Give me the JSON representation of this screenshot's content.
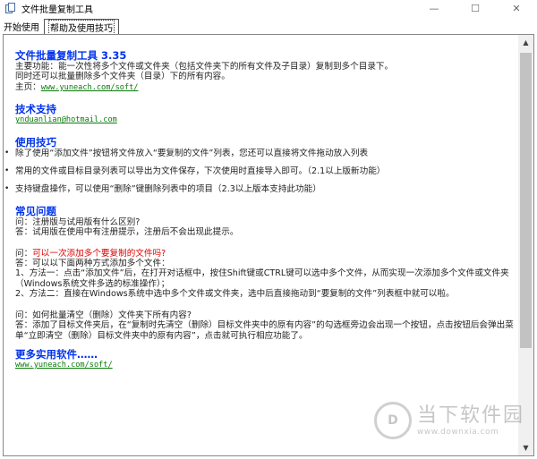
{
  "window": {
    "title": "文件批量复制工具",
    "controls": {
      "minimize": "—",
      "maximize": "☐",
      "close": "✕"
    }
  },
  "tabs": [
    {
      "label": "开始使用",
      "active": false
    },
    {
      "label": "帮助及使用技巧",
      "active": true
    }
  ],
  "help": {
    "product_heading": "文件批量复制工具 3.35",
    "features_line1": "主要功能：能一次性将多个文件或文件夹（包括文件夹下的所有文件及子目录）复制到多个目录下。",
    "features_line2": "同时还可以批量删除多个文件夹（目录）下的所有内容。",
    "homepage_label": "主页：",
    "homepage_link": "www.yuneach.com/soft/",
    "support_heading": "技术支持",
    "support_email": "ynduanlian@hotmail.com",
    "tips_heading": "使用技巧",
    "tips": [
      "除了使用“添加文件”按钮将文件放入“要复制的文件”列表，您还可以直接将文件拖动放入列表",
      "常用的文件或目标目录列表可以导出为文件保存，下次使用时直接导入即可。（2.1以上版新功能）",
      "支持键盘操作，可以使用“删除”键删除列表中的项目（2.3以上版本支持此功能）"
    ],
    "faq_heading": "常见问题",
    "faq1_q": "问：注册版与试用版有什么区别?",
    "faq1_a": "答：试用版在使用中有注册提示，注册后不会出现此提示。",
    "faq2_q_prefix": "问：",
    "faq2_q": "可以一次添加多个要复制的文件吗?",
    "faq2_a_line1": "答：可以以下面两种方式添加多个文件：",
    "faq2_a_line2": "1、方法一：点击“添加文件”后，在打开对话框中，按住Shift键或CTRL键可以选中多个文件，从而实现一次添加多个文件或文件夹（Windows系统文件多选的标准操作）；",
    "faq2_a_line3": "2、方法二：直接在Windows系统中选中多个文件或文件夹，选中后直接拖动到“要复制的文件”列表框中就可以啦。",
    "faq3_q": "问：如何批量清空（删除）文件夹下所有内容?",
    "faq3_a": "答：添加了目标文件夹后，在“复制时先清空（删除）目标文件夹中的原有内容”的勾选框旁边会出现一个按钮，点击按钮后会弹出菜单“立即清空（删除）目标文件夹中的原有内容”，点击就可执行相应功能了。",
    "more_heading": "更多实用软件……",
    "more_link": "www.yuneach.com/soft/"
  },
  "watermark": {
    "logo_text": "D",
    "text": "当下软件园",
    "url": "www.downxia.com"
  },
  "colors": {
    "heading": "#0033ee",
    "link": "#0a7a0a",
    "highlight": "#e00000"
  }
}
